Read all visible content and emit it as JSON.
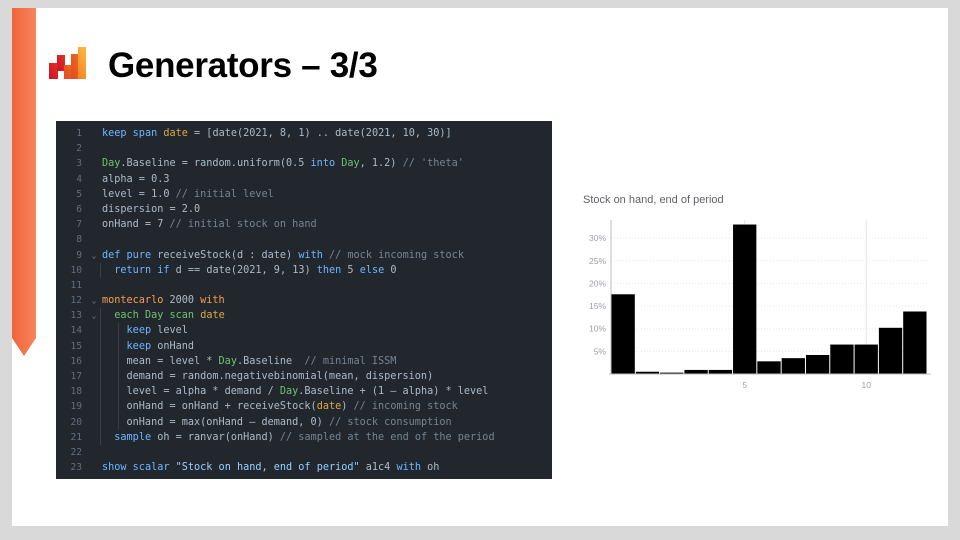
{
  "slide": {
    "title": "Generators – 3/3",
    "logo_name": "lokad-bar-logo",
    "accent_ribbon_color": "#F4764B",
    "background_color": "#D9D9D9",
    "slide_color": "#FFFFFF"
  },
  "code_block": {
    "background": "#22272E",
    "language": "envision",
    "lines": [
      {
        "n": "1",
        "fold": "",
        "tokens": [
          {
            "t": "keep ",
            "c": "k"
          },
          {
            "t": "span ",
            "c": "k"
          },
          {
            "t": "date",
            "c": "yl"
          },
          {
            "t": " = [",
            "c": "p"
          },
          {
            "t": "date",
            "c": "p"
          },
          {
            "t": "(2021, 8, 1) .. ",
            "c": "p"
          },
          {
            "t": "date",
            "c": "p"
          },
          {
            "t": "(2021, 10, 30)]",
            "c": "p"
          }
        ]
      },
      {
        "n": "2",
        "fold": "",
        "tokens": []
      },
      {
        "n": "3",
        "fold": "",
        "tokens": [
          {
            "t": "Day",
            "c": "ty"
          },
          {
            "t": ".Baseline = random.uniform(0.5 ",
            "c": "p"
          },
          {
            "t": "into",
            "c": "k"
          },
          {
            "t": " ",
            "c": "p"
          },
          {
            "t": "Day",
            "c": "ty"
          },
          {
            "t": ", 1.2) ",
            "c": "p"
          },
          {
            "t": "// 'theta'",
            "c": "cm"
          }
        ]
      },
      {
        "n": "4",
        "fold": "",
        "tokens": [
          {
            "t": "alpha = 0.3",
            "c": "p"
          }
        ]
      },
      {
        "n": "5",
        "fold": "",
        "tokens": [
          {
            "t": "level = 1.0 ",
            "c": "p"
          },
          {
            "t": "// initial level",
            "c": "cm"
          }
        ]
      },
      {
        "n": "6",
        "fold": "",
        "tokens": [
          {
            "t": "dispersion = 2.0",
            "c": "p"
          }
        ]
      },
      {
        "n": "7",
        "fold": "",
        "tokens": [
          {
            "t": "onHand = 7 ",
            "c": "p"
          },
          {
            "t": "// initial stock on hand",
            "c": "cm"
          }
        ]
      },
      {
        "n": "8",
        "fold": "",
        "tokens": []
      },
      {
        "n": "9",
        "fold": "v",
        "tokens": [
          {
            "t": "def ",
            "c": "k"
          },
          {
            "t": "pure ",
            "c": "k"
          },
          {
            "t": "receiveStock(d : ",
            "c": "p"
          },
          {
            "t": "date",
            "c": "p"
          },
          {
            "t": ") ",
            "c": "p"
          },
          {
            "t": "with",
            "c": "k"
          },
          {
            "t": " ",
            "c": "p"
          },
          {
            "t": "// mock incoming stock",
            "c": "cm"
          }
        ]
      },
      {
        "n": "10",
        "fold": "",
        "indent": 1,
        "tokens": [
          {
            "t": "  ",
            "c": "p"
          },
          {
            "t": "return",
            "c": "k"
          },
          {
            "t": " ",
            "c": "p"
          },
          {
            "t": "if",
            "c": "k"
          },
          {
            "t": " d == ",
            "c": "p"
          },
          {
            "t": "date",
            "c": "p"
          },
          {
            "t": "(2021, 9, 13) ",
            "c": "p"
          },
          {
            "t": "then",
            "c": "k"
          },
          {
            "t": " 5 ",
            "c": "p"
          },
          {
            "t": "else",
            "c": "k"
          },
          {
            "t": " 0",
            "c": "p"
          }
        ]
      },
      {
        "n": "11",
        "fold": "",
        "tokens": []
      },
      {
        "n": "12",
        "fold": "v",
        "tokens": [
          {
            "t": "montecarlo",
            "c": "kw"
          },
          {
            "t": " 2000 ",
            "c": "p"
          },
          {
            "t": "with",
            "c": "kw"
          }
        ]
      },
      {
        "n": "13",
        "fold": "v",
        "indent": 1,
        "tokens": [
          {
            "t": "  ",
            "c": "p"
          },
          {
            "t": "each",
            "c": "ty"
          },
          {
            "t": " ",
            "c": "p"
          },
          {
            "t": "Day",
            "c": "ty"
          },
          {
            "t": " ",
            "c": "p"
          },
          {
            "t": "scan",
            "c": "ty"
          },
          {
            "t": " ",
            "c": "p"
          },
          {
            "t": "date",
            "c": "yl"
          }
        ]
      },
      {
        "n": "14",
        "fold": "",
        "indent": 2,
        "tokens": [
          {
            "t": "    ",
            "c": "p"
          },
          {
            "t": "keep",
            "c": "k"
          },
          {
            "t": " level",
            "c": "p"
          }
        ]
      },
      {
        "n": "15",
        "fold": "",
        "indent": 2,
        "tokens": [
          {
            "t": "    ",
            "c": "p"
          },
          {
            "t": "keep",
            "c": "k"
          },
          {
            "t": " onHand",
            "c": "p"
          }
        ]
      },
      {
        "n": "16",
        "fold": "",
        "indent": 2,
        "tokens": [
          {
            "t": "    mean = level * ",
            "c": "p"
          },
          {
            "t": "Day",
            "c": "ty"
          },
          {
            "t": ".Baseline  ",
            "c": "p"
          },
          {
            "t": "// minimal ISSM",
            "c": "cm"
          }
        ]
      },
      {
        "n": "17",
        "fold": "",
        "indent": 2,
        "tokens": [
          {
            "t": "    demand = random.negativebinomial(mean, dispersion)",
            "c": "p"
          }
        ]
      },
      {
        "n": "18",
        "fold": "",
        "indent": 2,
        "tokens": [
          {
            "t": "    level = alpha * demand / ",
            "c": "p"
          },
          {
            "t": "Day",
            "c": "ty"
          },
          {
            "t": ".Baseline + (1 – alpha) * level",
            "c": "p"
          }
        ]
      },
      {
        "n": "19",
        "fold": "",
        "indent": 2,
        "tokens": [
          {
            "t": "    onHand = onHand + ",
            "c": "p"
          },
          {
            "t": "receiveStock",
            "c": "p"
          },
          {
            "t": "(",
            "c": "p"
          },
          {
            "t": "date",
            "c": "yl"
          },
          {
            "t": ") ",
            "c": "p"
          },
          {
            "t": "// incoming stock",
            "c": "cm"
          }
        ]
      },
      {
        "n": "20",
        "fold": "",
        "indent": 2,
        "tokens": [
          {
            "t": "    onHand = max(onHand – demand, 0) ",
            "c": "p"
          },
          {
            "t": "// stock consumption",
            "c": "cm"
          }
        ]
      },
      {
        "n": "21",
        "fold": "",
        "indent": 1,
        "tokens": [
          {
            "t": "  ",
            "c": "p"
          },
          {
            "t": "sample",
            "c": "k"
          },
          {
            "t": " oh = ranvar(onHand) ",
            "c": "p"
          },
          {
            "t": "// sampled at the end of the period",
            "c": "cm"
          }
        ]
      },
      {
        "n": "22",
        "fold": "",
        "tokens": []
      },
      {
        "n": "23",
        "fold": "",
        "tokens": [
          {
            "t": "show ",
            "c": "k"
          },
          {
            "t": "scalar",
            "c": "k"
          },
          {
            "t": " ",
            "c": "p"
          },
          {
            "t": "\"Stock on hand, end of period\"",
            "c": "st"
          },
          {
            "t": " a1c4 ",
            "c": "p"
          },
          {
            "t": "with",
            "c": "k"
          },
          {
            "t": " oh",
            "c": "p"
          }
        ]
      }
    ]
  },
  "chart_data": {
    "type": "bar",
    "title": "Stock on hand, end of period",
    "xlabel": "",
    "ylabel": "",
    "categories": [
      "0",
      "1",
      "2",
      "3",
      "4",
      "5",
      "6",
      "7",
      "8",
      "9",
      "10",
      "11",
      "12",
      "13"
    ],
    "values": [
      17.6,
      0.5,
      0.3,
      0.9,
      0.9,
      33.0,
      2.8,
      3.5,
      4.2,
      6.5,
      6.5,
      10.2,
      13.8
    ],
    "x_ticks": [
      {
        "value": "5",
        "pos": 5
      },
      {
        "value": "10",
        "pos": 10
      }
    ],
    "y_ticks": [
      "5%",
      "10%",
      "15%",
      "20%",
      "25%",
      "30%"
    ],
    "ylim": [
      0,
      34
    ],
    "grid": true,
    "legend": "none",
    "bar_color": "#000000",
    "axis_color": "#9AA0A6"
  }
}
